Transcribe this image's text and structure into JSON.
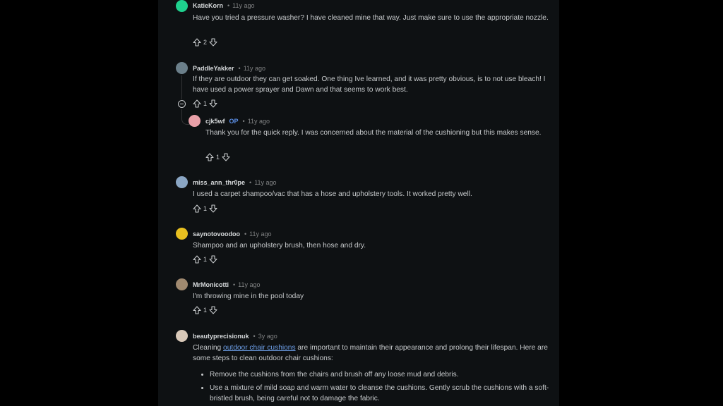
{
  "comments": [
    {
      "username": "KatieKorn",
      "time": "11y ago",
      "body": "Have you tried a pressure washer? I have cleaned mine that way. Just make sure to use the appropriate nozzle.",
      "votes": "2",
      "avatar_color": "#1fd18e"
    },
    {
      "username": "PaddleYakker",
      "time": "11y ago",
      "body": "If they are outdoor they can get soaked. One thing Ive learned, and it was pretty obvious, is to not use bleach! I have used a power sprayer and Dawn and that seems to work best.",
      "votes": "1",
      "avatar_color": "#6b7f8a"
    },
    {
      "username": "cjk5wf",
      "op_label": "OP",
      "time": "11y ago",
      "body": "Thank you for the quick reply. I was concerned about the material of the cushioning but this makes sense.",
      "votes": "1",
      "avatar_color": "#e8a0a8"
    },
    {
      "username": "miss_ann_thr0pe",
      "time": "11y ago",
      "body": "I used a carpet shampoo/vac that has a hose and upholstery tools. It worked pretty well.",
      "votes": "1",
      "avatar_color": "#8aa6c4"
    },
    {
      "username": "saynotovoodoo",
      "time": "11y ago",
      "body": "Shampoo and an upholstery brush, then hose and dry.",
      "votes": "1",
      "avatar_color": "#e8c020"
    },
    {
      "username": "MrMonicotti",
      "time": "11y ago",
      "body": "I'm throwing mine in the pool today",
      "votes": "1",
      "avatar_color": "#a08a70"
    },
    {
      "username": "beautyprecisionuk",
      "time": "3y ago",
      "body_before": "Cleaning ",
      "link_text": "outdoor chair cushions",
      "body_after": " are important to maintain their appearance and prolong their lifespan. Here are some steps to clean outdoor chair cushions:",
      "steps": [
        "Remove the cushions from the chairs and brush off any loose mud and debris.",
        "Use a mixture of mild soap and warm water to cleanse the cushions. Gently scrub the cushions with a soft-bristled brush, being careful not to damage the fabric."
      ],
      "avatar_color": "#d8c8b8"
    }
  ]
}
